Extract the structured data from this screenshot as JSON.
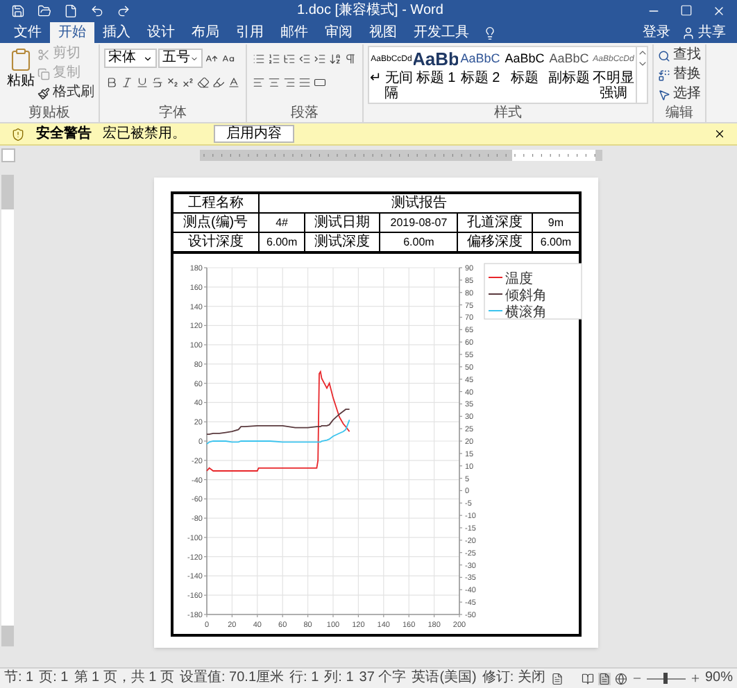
{
  "window": {
    "title": "1.doc [兼容模式] - Word"
  },
  "tabs": [
    {
      "label": "文件",
      "selected": false
    },
    {
      "label": "开始",
      "selected": true
    },
    {
      "label": "插入",
      "selected": false
    },
    {
      "label": "设计",
      "selected": false
    },
    {
      "label": "布局",
      "selected": false
    },
    {
      "label": "引用",
      "selected": false
    },
    {
      "label": "邮件",
      "selected": false
    },
    {
      "label": "审阅",
      "selected": false
    },
    {
      "label": "视图",
      "selected": false
    },
    {
      "label": "开发工具",
      "selected": false
    }
  ],
  "account": {
    "sign_in": "登录",
    "share": "共享"
  },
  "clipboard": {
    "label": "剪贴板",
    "paste": "粘贴",
    "actions": [
      {
        "label": "剪切",
        "disabled": true
      },
      {
        "label": "复制",
        "disabled": true
      },
      {
        "label": "格式刷",
        "disabled": false
      }
    ]
  },
  "font": {
    "label": "字体",
    "name": "宋体",
    "size": "五号"
  },
  "paragraph": {
    "label": "段落"
  },
  "styles": {
    "label": "样式",
    "items": [
      {
        "kind": "normal",
        "preview": "AaBbCcDd",
        "name": "↵ 无间隔"
      },
      {
        "kind": "heading1",
        "preview": "AaBb",
        "name": "标题 1"
      },
      {
        "kind": "heading2",
        "preview": "AaBbC",
        "name": "标题 2"
      },
      {
        "kind": "title",
        "preview": "AaBbC",
        "name": "标题"
      },
      {
        "kind": "subtitle",
        "preview": "AaBbC",
        "name": "副标题"
      },
      {
        "kind": "emphasis",
        "preview": "AaBbCcDd",
        "name": "不明显强调"
      }
    ]
  },
  "editing": {
    "label": "编辑",
    "actions": [
      {
        "label": "查找"
      },
      {
        "label": "替换"
      },
      {
        "label": "选择"
      }
    ]
  },
  "security_bar": {
    "title": "安全警告",
    "message": "宏已被禁用。",
    "button": "启用内容"
  },
  "document": {
    "table": {
      "title_row": {
        "label": "工程名称",
        "value": "测试报告"
      },
      "rows": [
        [
          {
            "label": "测点(编)号",
            "value": "4#"
          },
          {
            "label": "测试日期",
            "value": "2019-08-07"
          },
          {
            "label": "孔道深度",
            "value": "9m"
          }
        ],
        [
          {
            "label": "设计深度",
            "value": "6.00m"
          },
          {
            "label": "测试深度",
            "value": "6.00m"
          },
          {
            "label": "偏移深度",
            "value": "6.00m"
          }
        ]
      ]
    },
    "chart": {
      "right_axis_ticks": [
        "90",
        "85",
        "80",
        "75",
        "70",
        "65",
        "60",
        "55",
        "50",
        "45",
        "40",
        "35",
        "30",
        "25",
        "20",
        "15",
        "10",
        "5",
        "0",
        "-5",
        "-10",
        "-15",
        "-20",
        "-25",
        "-30",
        "-35",
        "-40",
        "-45",
        "-50"
      ],
      "chart_data": {
        "type": "line",
        "grid": true,
        "legend": true,
        "x": [
          0,
          2,
          5,
          10,
          15,
          20,
          25,
          27,
          30,
          40,
          41,
          50,
          60,
          70,
          80,
          87,
          88,
          89,
          90,
          91,
          95,
          97,
          100,
          105,
          108,
          110,
          113
        ],
        "xlim": [
          0,
          200
        ],
        "ylim": [
          -180,
          180
        ],
        "xticks": [
          0,
          20,
          40,
          60,
          80,
          100,
          120,
          140,
          160,
          180,
          200
        ],
        "yticks": [
          180,
          160,
          140,
          120,
          100,
          80,
          60,
          40,
          20,
          0,
          -20,
          -40,
          -60,
          -80,
          -100,
          -120,
          -140,
          -160,
          -180
        ],
        "series": [
          {
            "name": "温度",
            "color": "#e8262a",
            "values": [
              -31,
              -28,
              -31,
              -31,
              -31,
              -31,
              -31,
              -31,
              -31,
              -31,
              -28,
              -28,
              -28,
              -28,
              -28,
              -28,
              -20,
              70,
              72,
              65,
              55,
              60,
              45,
              25,
              18,
              15,
              10
            ]
          },
          {
            "name": "倾斜角",
            "color": "#5a3a3e",
            "values": [
              7,
              7,
              8,
              8,
              9,
              10,
              12,
              15,
              15,
              16,
              16,
              16,
              16,
              14,
              14,
              15,
              15,
              15,
              15,
              16,
              16,
              17,
              22,
              28,
              31,
              33,
              33
            ]
          },
          {
            "name": "横滚角",
            "color": "#3cc4ee",
            "values": [
              -3,
              -1,
              0,
              0,
              0,
              -1,
              -1,
              0,
              0,
              0,
              0,
              0,
              -1,
              -1,
              -1,
              -1,
              -1,
              -1,
              -1,
              0,
              1,
              2,
              5,
              8,
              10,
              12,
              22
            ]
          }
        ]
      }
    }
  },
  "status_bar": {
    "items": [
      "节: 1",
      "页: 1",
      "第 1 页，共 1 页",
      "设置值: 70.1厘米",
      "行: 1",
      "列: 1",
      "37 个字",
      "英语(美国)",
      "修订: 关闭"
    ],
    "zoom": {
      "level": 0.5,
      "reading": "90%"
    }
  }
}
